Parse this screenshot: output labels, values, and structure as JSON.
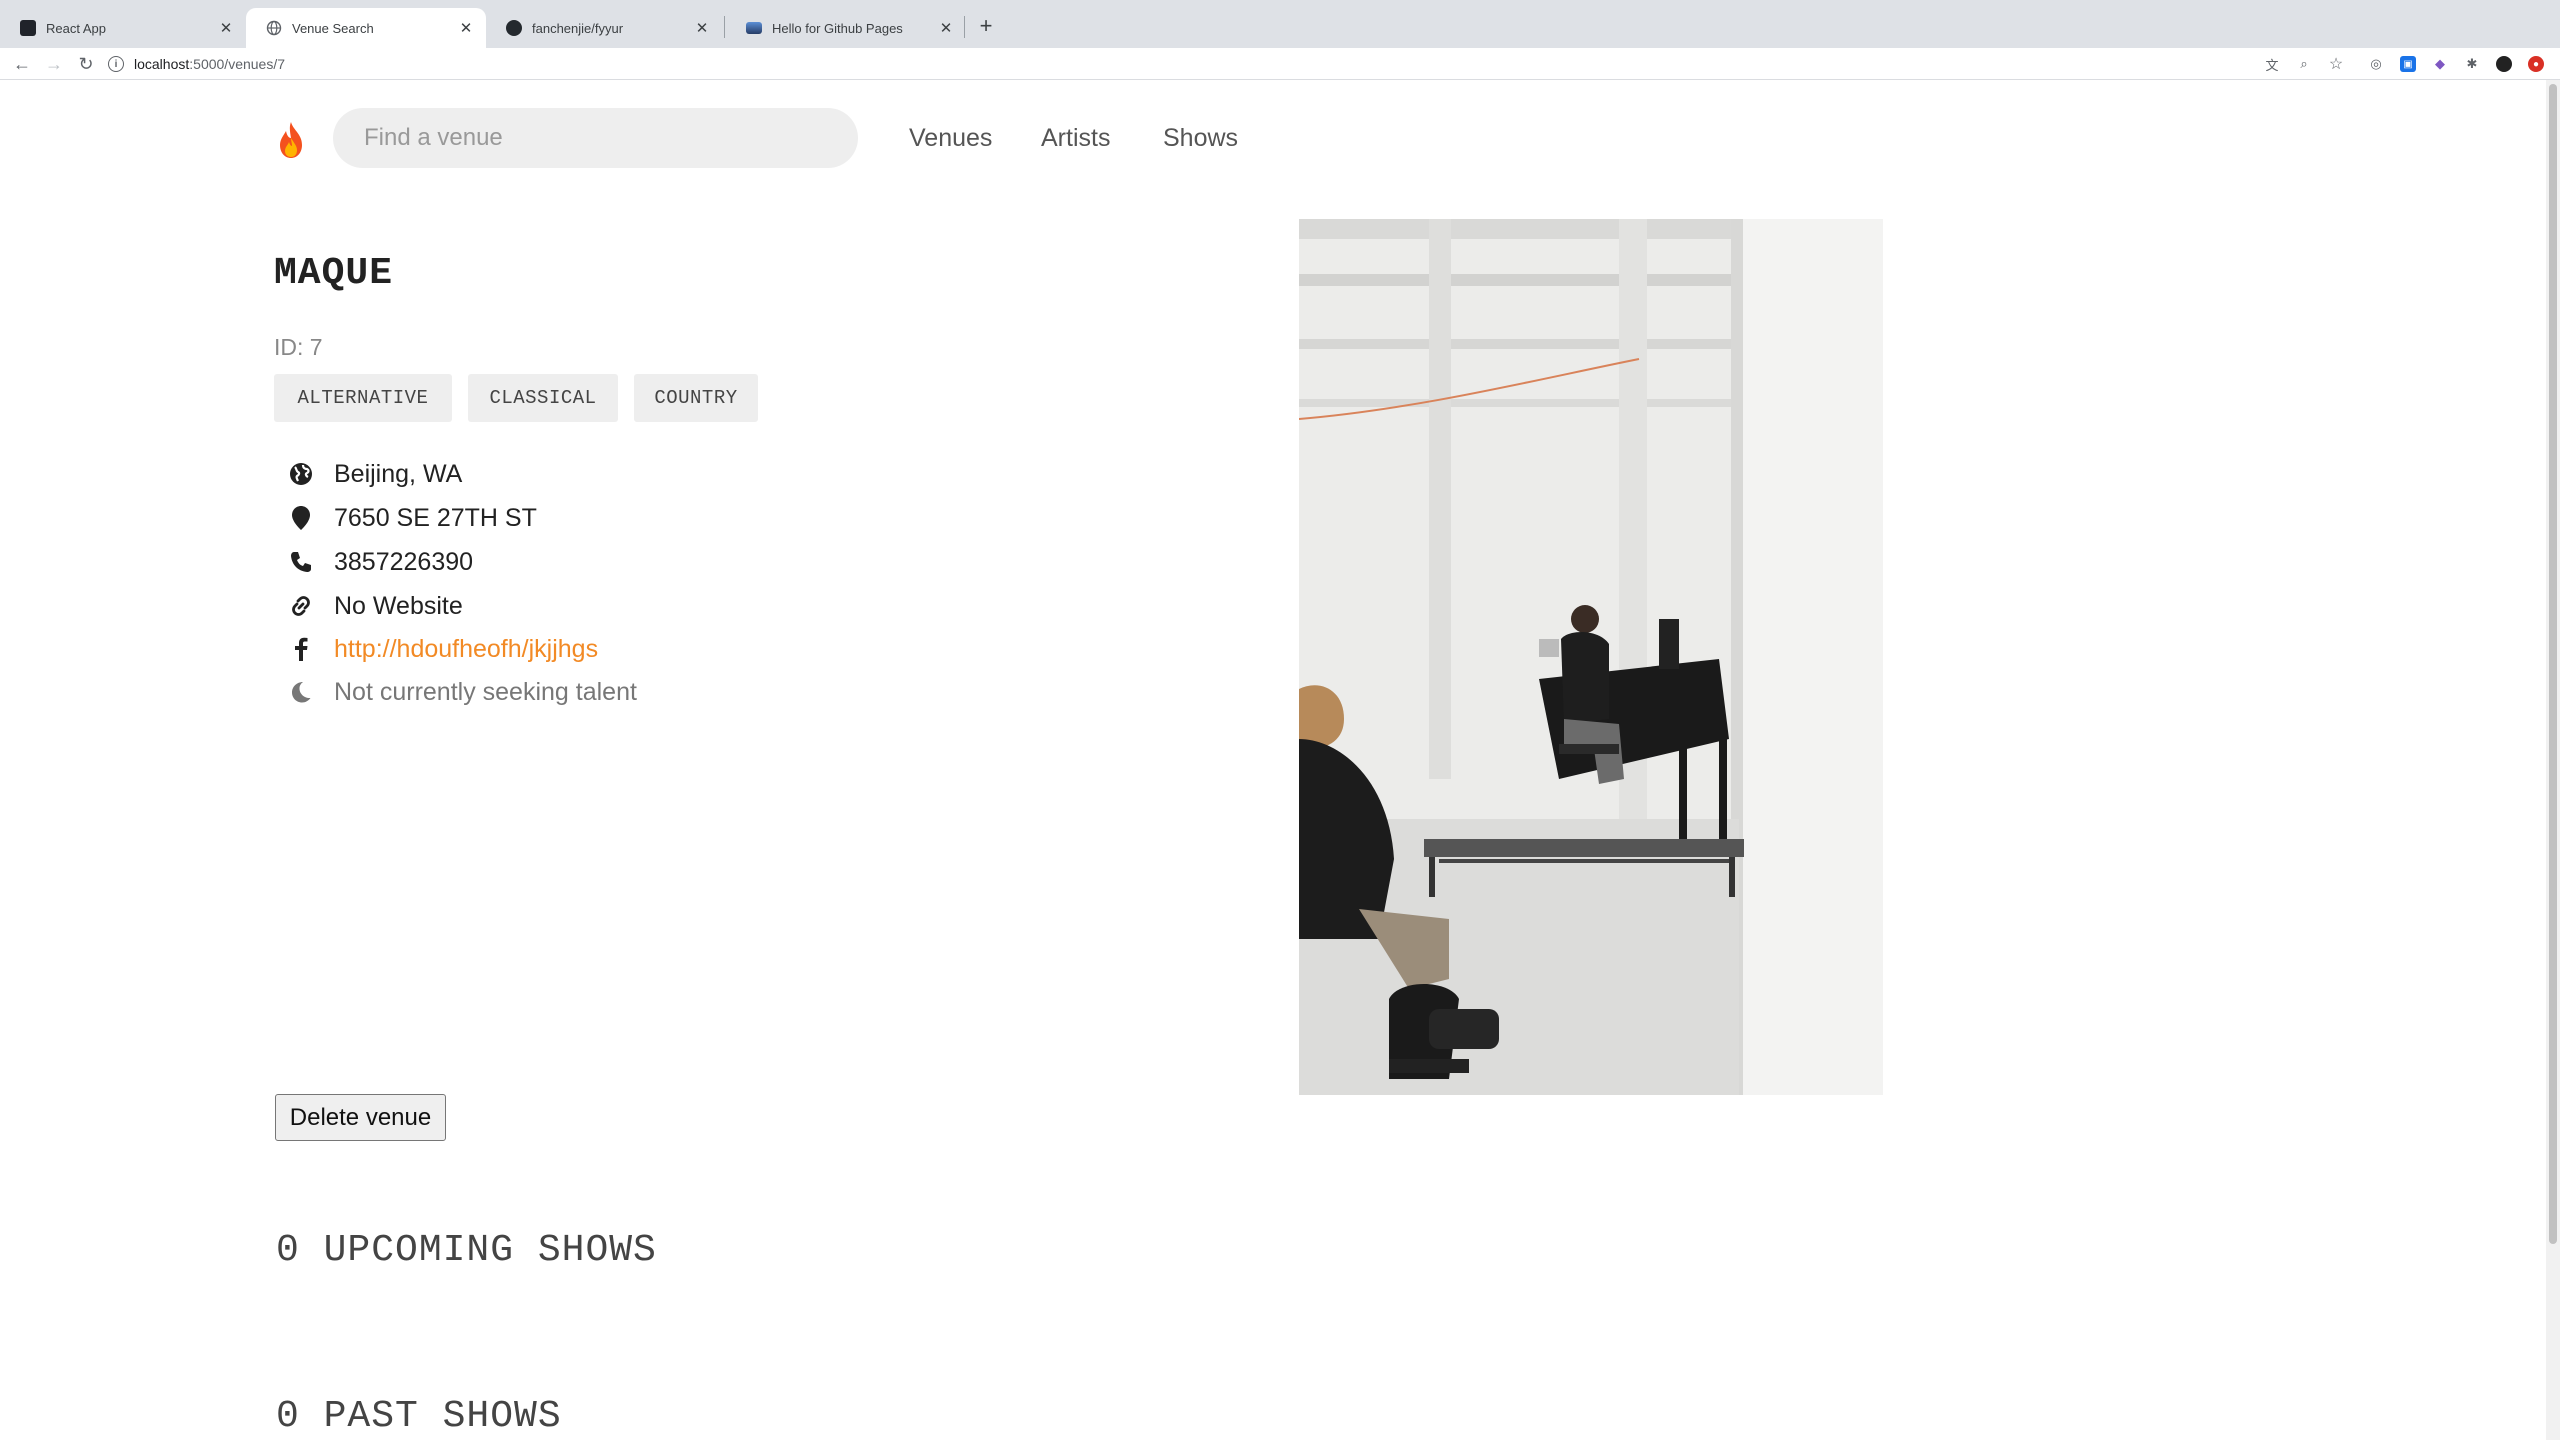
{
  "browser": {
    "tabs": [
      {
        "title": "React App",
        "active": false
      },
      {
        "title": "Venue Search",
        "active": true
      },
      {
        "title": "fanchenjie/fyyur",
        "active": false
      },
      {
        "title": "Hello for Github Pages",
        "active": false
      }
    ],
    "url_host": "localhost",
    "url_path": ":5000/venues/7"
  },
  "nav": {
    "search_placeholder": "Find a venue",
    "links": [
      "Venues",
      "Artists",
      "Shows"
    ]
  },
  "venue": {
    "name": "MAQUE",
    "id_text": "ID: 7",
    "genres": [
      "ALTERNATIVE",
      "CLASSICAL",
      "COUNTRY"
    ],
    "city_state": "Beijing, WA",
    "address": "7650 SE 27TH ST",
    "phone": "3857226390",
    "website": "No Website",
    "facebook": "http://hdoufheofh/jkjjhgs",
    "seeking": "Not currently seeking talent",
    "delete_label": "Delete venue"
  },
  "shows": {
    "upcoming": "0 UPCOMING SHOWS",
    "past": "0 PAST SHOWS"
  },
  "colors": {
    "link": "#f28a25",
    "chip_bg": "#eeeeee",
    "search_bg": "#eeeeee"
  },
  "icons": [
    "globe-icon",
    "map-marker-icon",
    "phone-icon",
    "link-icon",
    "facebook-icon",
    "moon-icon",
    "fire-icon"
  ]
}
